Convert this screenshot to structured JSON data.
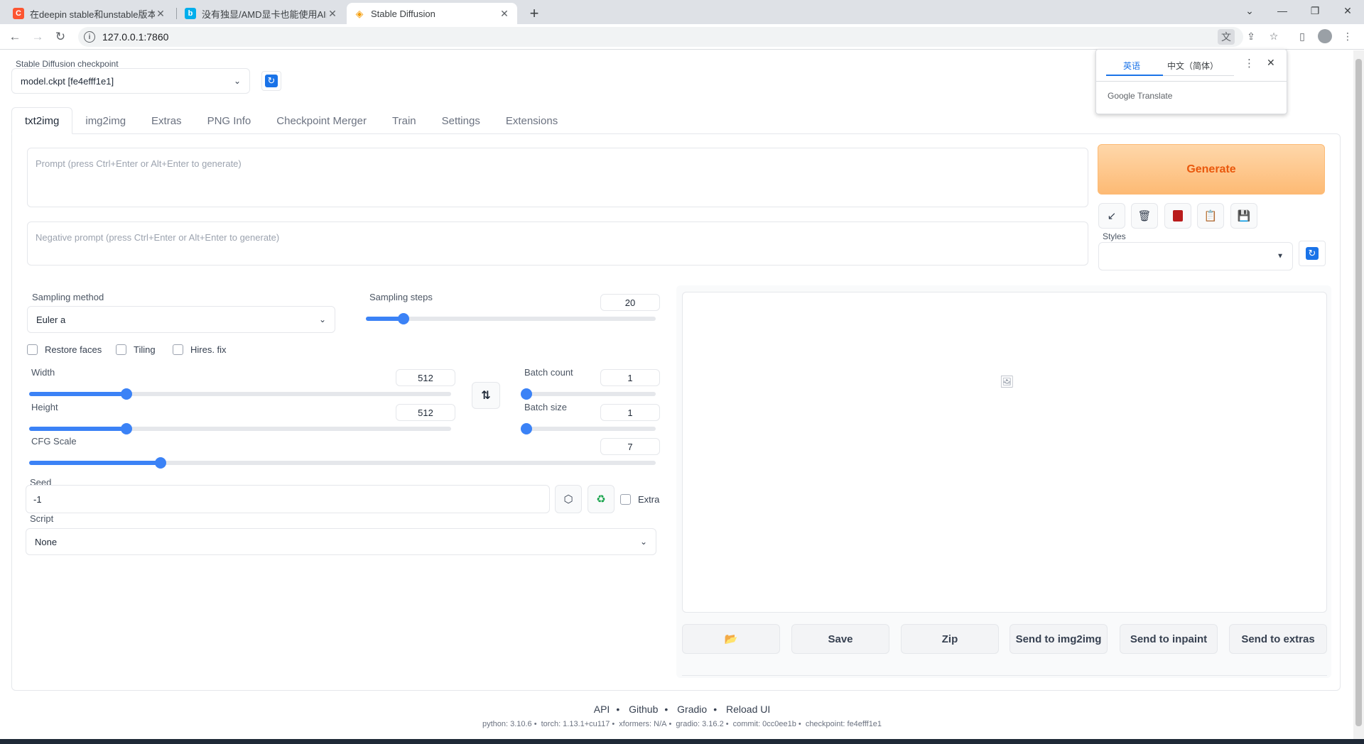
{
  "browser": {
    "tabs": [
      {
        "title": "在deepin stable和unstable版本",
        "favicon": "csdn-icon",
        "color": "#fc5531"
      },
      {
        "title": "没有独显/AMD显卡也能使用AI画",
        "favicon": "bilibili-icon",
        "color": "#00aeec"
      },
      {
        "title": "Stable Diffusion",
        "favicon": "stable-diffusion-icon",
        "color": "#f59e0b"
      }
    ],
    "url": "127.0.0.1:7860"
  },
  "translate_popup": {
    "lang_source": "英语",
    "lang_target": "中文（简体）",
    "brand": "Google Translate"
  },
  "checkpoint": {
    "label": "Stable Diffusion checkpoint",
    "value": "model.ckpt [fe4efff1e1]"
  },
  "main_tabs": [
    "txt2img",
    "img2img",
    "Extras",
    "PNG Info",
    "Checkpoint Merger",
    "Train",
    "Settings",
    "Extensions"
  ],
  "prompt": {
    "placeholder": "Prompt (press Ctrl+Enter or Alt+Enter to generate)",
    "negative_placeholder": "Negative prompt (press Ctrl+Enter or Alt+Enter to generate)"
  },
  "generate": {
    "label": "Generate",
    "styles_label": "Styles",
    "tools": [
      "arrow-icon",
      "trash-icon",
      "card-icon",
      "clipboard-icon",
      "save-icon"
    ]
  },
  "sampling": {
    "method_label": "Sampling method",
    "method_value": "Euler a",
    "steps_label": "Sampling steps",
    "steps_value": "20",
    "steps_fraction": 0.13
  },
  "checkboxes": {
    "restore_faces": "Restore faces",
    "tiling": "Tiling",
    "hires_fix": "Hires. fix"
  },
  "dimensions": {
    "width_label": "Width",
    "width_value": "512",
    "width_fraction": 0.23,
    "height_label": "Height",
    "height_value": "512",
    "height_fraction": 0.23,
    "swap_icon": "swap-icon"
  },
  "batch": {
    "count_label": "Batch count",
    "count_value": "1",
    "size_label": "Batch size",
    "size_value": "1"
  },
  "cfg": {
    "label": "CFG Scale",
    "value": "7",
    "fraction": 0.21
  },
  "seed": {
    "label": "Seed",
    "value": "-1",
    "extra_label": "Extra"
  },
  "script": {
    "label": "Script",
    "value": "None"
  },
  "output": {
    "buttons": [
      "Save",
      "Zip",
      "Send to img2img",
      "Send to inpaint",
      "Send to extras"
    ]
  },
  "footer": {
    "links": [
      "API",
      "Github",
      "Gradio",
      "Reload UI"
    ],
    "versions": [
      "python: 3.10.6",
      "torch: 1.13.1+cu117",
      "xformers: N/A",
      "gradio: 3.16.2",
      "commit: 0cc0ee1b",
      "checkpoint: fe4efff1e1"
    ]
  },
  "colors": {
    "accent": "#3b82f6",
    "generate_bg": "#fdba74",
    "generate_text": "#ea580c"
  }
}
